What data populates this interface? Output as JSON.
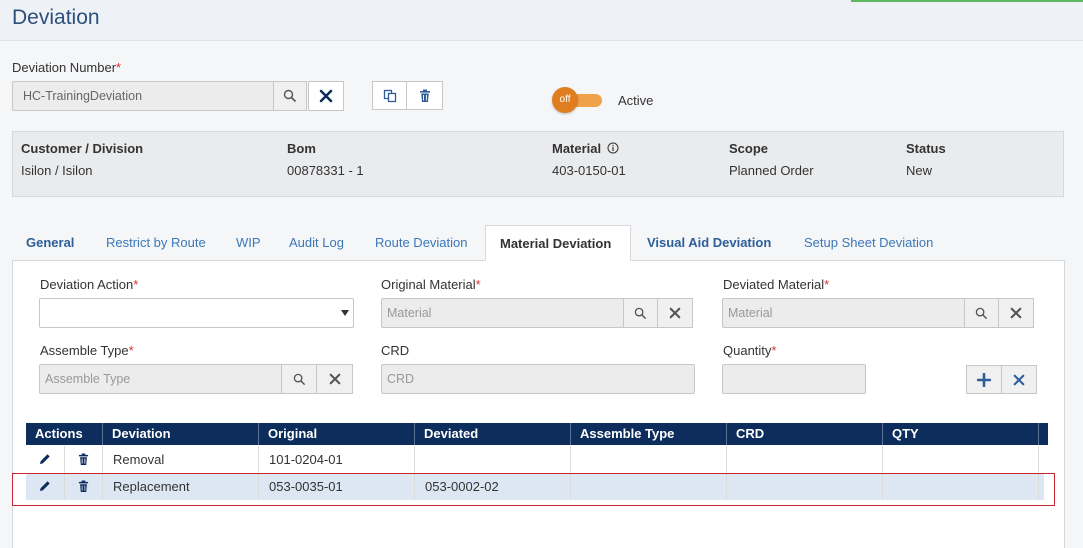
{
  "page": {
    "title": "Deviation"
  },
  "deviation_number": {
    "label": "Deviation Number",
    "required_mark": "*",
    "value": "HC-TrainingDeviation"
  },
  "active_toggle": {
    "state_label": "off",
    "label": "Active"
  },
  "info": {
    "customer_label": "Customer / Division",
    "customer_value": "Isilon / Isilon",
    "bom_label": "Bom",
    "bom_value": "00878331 - 1",
    "material_label": "Material",
    "material_value": "403-0150-01",
    "scope_label": "Scope",
    "scope_value": "Planned Order",
    "status_label": "Status",
    "status_value": "New"
  },
  "tabs": [
    {
      "label": "General"
    },
    {
      "label": "Restrict by Route"
    },
    {
      "label": "WIP"
    },
    {
      "label": "Audit Log"
    },
    {
      "label": "Route Deviation"
    },
    {
      "label": "Material Deviation"
    },
    {
      "label": "Visual Aid Deviation"
    },
    {
      "label": "Setup Sheet Deviation"
    }
  ],
  "form": {
    "deviation_action_label": "Deviation Action",
    "original_material_label": "Original Material",
    "original_material_placeholder": "Material",
    "deviated_material_label": "Deviated Material",
    "deviated_material_placeholder": "Material",
    "assemble_type_label": "Assemble Type",
    "assemble_type_placeholder": "Assemble Type",
    "crd_label": "CRD",
    "crd_placeholder": "CRD",
    "quantity_label": "Quantity",
    "required_mark": "*"
  },
  "grid": {
    "columns": [
      "Actions",
      "Deviation",
      "Original",
      "Deviated",
      "Assemble Type",
      "CRD",
      "QTY"
    ],
    "rows": [
      {
        "deviation": "Removal",
        "original": "101-0204-01",
        "deviated": "",
        "assemble_type": "",
        "crd": "",
        "qty": ""
      },
      {
        "deviation": "Replacement",
        "original": "053-0035-01",
        "deviated": "053-0002-02",
        "assemble_type": "",
        "crd": "",
        "qty": ""
      }
    ]
  },
  "colors": {
    "header_navy": "#0d2d5c",
    "accent_blue": "#3b78b8",
    "toggle_orange": "#e07e1f",
    "required_red": "#d9302c",
    "selection_outline": "#c9252c"
  }
}
